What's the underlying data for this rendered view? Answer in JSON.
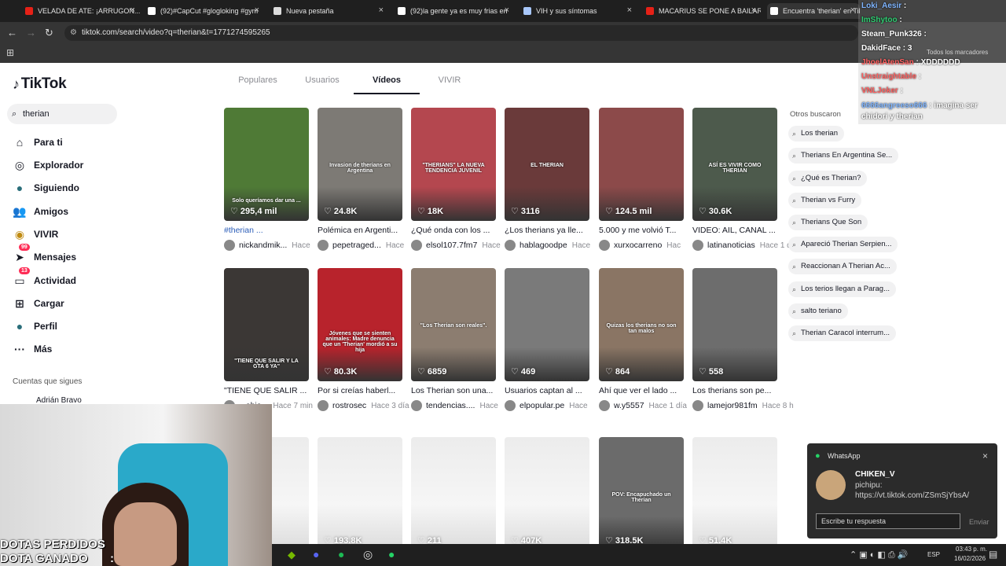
{
  "browser": {
    "tabs": [
      {
        "title": "VELADA DE ATE: ¡ARRUGON...",
        "color": "#e62117"
      },
      {
        "title": "(92)#CapCut #glogloking #gym",
        "color": "#ffffff"
      },
      {
        "title": "Nueva pestaña",
        "color": "#dcdcdc"
      },
      {
        "title": "(92)la gente ya es muy frias en",
        "color": "#ffffff"
      },
      {
        "title": "VIH y sus síntomas",
        "color": "#a8c7fa"
      },
      {
        "title": "MACARIUS SE PONE A BAILAR",
        "color": "#e62117"
      },
      {
        "title": "Encuentra 'therian' en TikTok",
        "color": "#ffffff"
      }
    ],
    "url": "tiktok.com/search/video?q=therian&t=1771274595265",
    "bookmarks_label": "Todos los marcadores"
  },
  "tiktok": {
    "logo": "TikTok",
    "search_value": "therian",
    "nav": [
      {
        "label": "Para ti",
        "icon": "home-icon",
        "glyph": "⌂",
        "badge": ""
      },
      {
        "label": "Explorador",
        "icon": "compass-icon",
        "glyph": "◎",
        "badge": ""
      },
      {
        "label": "Siguiendo",
        "icon": "avatar-icon",
        "glyph": "●",
        "badge": ""
      },
      {
        "label": "Amigos",
        "icon": "friends-icon",
        "glyph": "👥",
        "badge": ""
      },
      {
        "label": "VIVIR",
        "icon": "live-icon",
        "glyph": "◉",
        "badge": ""
      },
      {
        "label": "Mensajes",
        "icon": "message-icon",
        "glyph": "➤",
        "badge": "99"
      },
      {
        "label": "Actividad",
        "icon": "inbox-icon",
        "glyph": "▭",
        "badge": "13"
      },
      {
        "label": "Cargar",
        "icon": "upload-icon",
        "glyph": "⊞",
        "badge": ""
      },
      {
        "label": "Perfil",
        "icon": "profile-avatar-icon",
        "glyph": "●",
        "badge": ""
      },
      {
        "label": "Más",
        "icon": "more-icon",
        "glyph": "···",
        "badge": ""
      }
    ],
    "following_header": "Cuentas que sigues",
    "following_user": "Adrián Bravo",
    "tabs": [
      "Populares",
      "Usuarios",
      "Vídeos",
      "VIVIR"
    ],
    "selected_tab": 2,
    "others_title": "Otros buscaron",
    "others": [
      "Los therian",
      "Therians En Argentina Se...",
      "¿Qué es Therian?",
      "Therian vs Furry",
      "Therians Que Son",
      "Apareció Therian Serpien...",
      "Reaccionan A Therian Ac...",
      "Los terios llegan a Parag...",
      "salto teriano",
      "Therian Caracol interrum..."
    ],
    "row1": [
      {
        "likes": "295,4 mil",
        "caption": "#therian ...",
        "user": "nickandmik...",
        "ago": "Hace",
        "overlay": "Solo queríamos dar una ...",
        "bg": "#4f7a36"
      },
      {
        "likes": "24.8K",
        "caption": "Polémica en Argenti...",
        "user": "pepetraged...",
        "ago": "Hace",
        "overlay": "Invasion de therians en Argentina",
        "bg": "#7d7a75"
      },
      {
        "likes": "18K",
        "caption": "¿Qué onda con los ...",
        "user": "elsol107.7fm7",
        "ago": "Hace",
        "overlay": "\"THERIANS\" LA NUEVA TENDENCIA JUVENIL",
        "bg": "#b4474f"
      },
      {
        "likes": "3116",
        "caption": "¿Los therians ya lle...",
        "user": "hablagoodpe",
        "ago": "Hace",
        "overlay": "EL THERIAN",
        "bg": "#6a3a3a"
      },
      {
        "likes": "124.5 mil",
        "caption": "5.000 y me volvió T...",
        "user": "xurxocarreno",
        "ago": "Hac",
        "overlay": "",
        "bg": "#8c4a4a"
      },
      {
        "likes": "30.6K",
        "caption": "VIDEO: AIL, CANAL ...",
        "user": "latinanoticias",
        "ago": "Hace 1 d",
        "overlay": "ASÍ ES VIVIR COMO THERIAN",
        "bg": "#4d5a4c"
      }
    ],
    "row2": [
      {
        "likes": "",
        "caption": "\"TIENE QUE SALIR ...",
        "user": "...ohia...",
        "ago": "Hace 7 min",
        "overlay": "\"TIENE QUE SALIR Y LA GTA 6 YA\"",
        "bg": "#3b3735"
      },
      {
        "likes": "80.3K",
        "caption": "Por si creías haberl...",
        "user": "rostrosec",
        "ago": "Hace 3 día",
        "overlay": "Jóvenes que se sienten animales: Madre denuncia que un 'Therian' mordió a su hija",
        "bg": "#b8232c"
      },
      {
        "likes": "6859",
        "caption": "Los Therian son una...",
        "user": "tendencias....",
        "ago": "Hace",
        "overlay": "\"Los Therian son reales\".",
        "bg": "#8c7d70"
      },
      {
        "likes": "469",
        "caption": "Usuarios captan al ...",
        "user": "elpopular.pe",
        "ago": "Hace",
        "overlay": "",
        "bg": "#7a7a7a"
      },
      {
        "likes": "864",
        "caption": "Ahí que ver el lado ...",
        "user": "w.y5557",
        "ago": "Hace 1 día",
        "overlay": "Quizas los therians no son tan malos",
        "bg": "#8a7564"
      },
      {
        "likes": "558",
        "caption": "Los therians son pe...",
        "user": "lamejor981fm",
        "ago": "Hace 8 h",
        "overlay": "",
        "bg": "#6d6d6d"
      }
    ],
    "row3": [
      {
        "likes": "",
        "overlay": "",
        "bg": "#efefef"
      },
      {
        "likes": "193.8K",
        "overlay": "",
        "bg": "#efefef"
      },
      {
        "likes": "211",
        "overlay": "",
        "bg": "#efefef"
      },
      {
        "likes": "407K",
        "overlay": "",
        "bg": "#efefef"
      },
      {
        "likes": "318.5K",
        "overlay": "POV: Encapuchado un Therian",
        "bg": "#6b6b6b"
      },
      {
        "likes": "51.4K",
        "overlay": "",
        "bg": "#efefef"
      }
    ]
  },
  "chat": [
    {
      "user": "Loki_Aesir",
      "msg": ":",
      "color": "#7fb5ff"
    },
    {
      "user": "ImShytoo",
      "msg": ":",
      "color": "#2ecc71"
    },
    {
      "user": "Steam_Punk326",
      "msg": ":",
      "color": "#ffffff"
    },
    {
      "user": "DakidFace",
      "msg": ": 3",
      "color": "#ffffff"
    },
    {
      "user": "JhoelAtenSan",
      "msg": ": XDDDDDD",
      "color": "#ff6060"
    },
    {
      "user": "Unstraightable",
      "msg": ":",
      "color": "#ff6060"
    },
    {
      "user": "VNLJoker",
      "msg": ":",
      "color": "#ff6060"
    },
    {
      "user": "6666angreeso666",
      "msg": ": imagina ser chidori y therian",
      "color": "#7fb5ff"
    }
  ],
  "stream": {
    "line1": "DOTAS PERDIDOS",
    "line2": "DOTA GANADO",
    "sep": ":"
  },
  "whatsapp": {
    "app": "WhatsApp",
    "sender": "CHIKEN_V",
    "message": "pichipu: https://vt.tiktok.com/ZSmSjYbsA/",
    "reply_placeholder": "Escribe tu respuesta",
    "send": "Enviar"
  },
  "taskbar": {
    "lang": "ESP",
    "time": "03:43 p. m.",
    "date": "16/02/2026"
  }
}
